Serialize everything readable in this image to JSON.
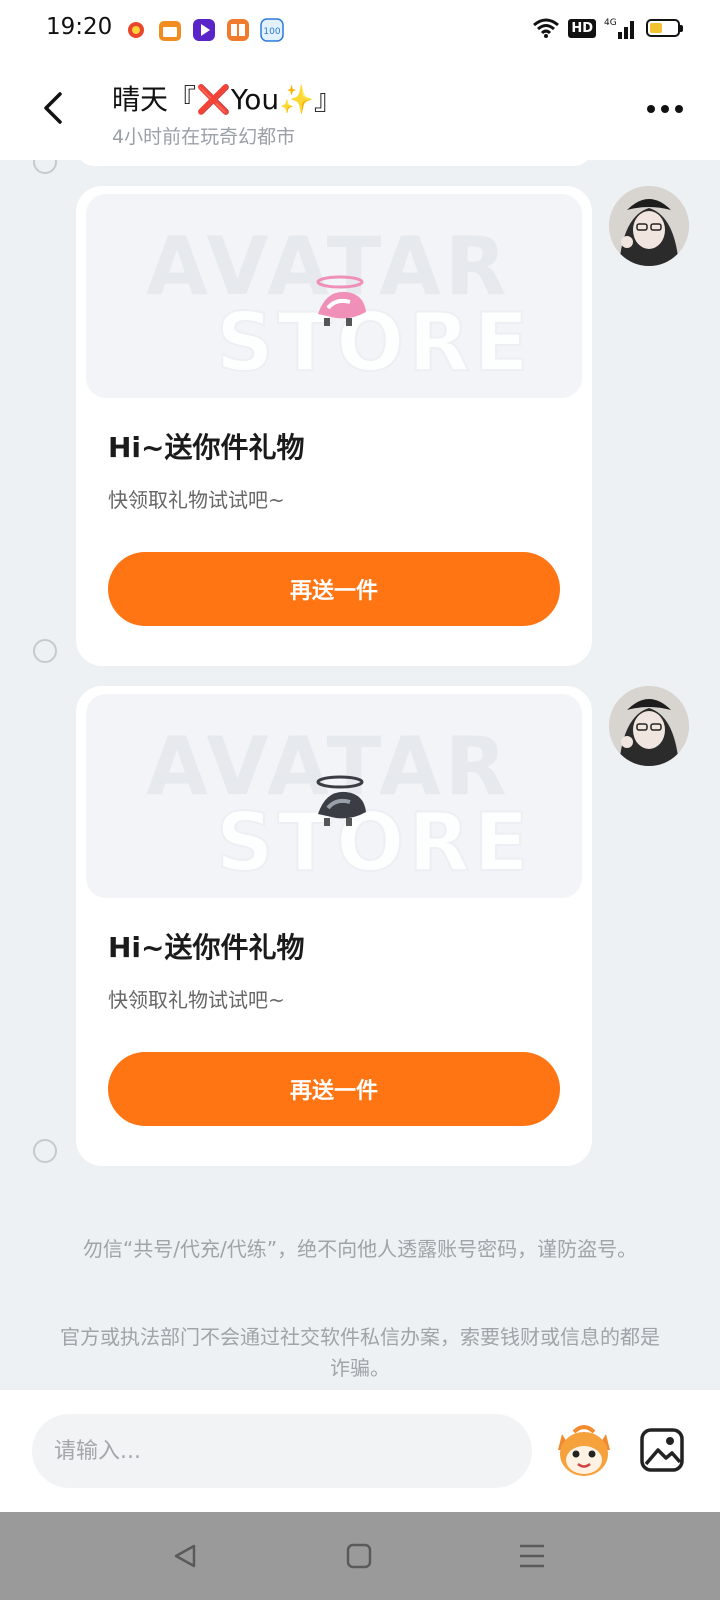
{
  "status_bar": {
    "time": "19:20",
    "app_icons": [
      "weather-icon",
      "calendar-icon",
      "video-icon",
      "book-icon",
      "score-app-icon"
    ],
    "indicators": {
      "hd": "HD",
      "network": "4G"
    }
  },
  "header": {
    "title": "晴天『❌You✨』",
    "subtitle": "4小时前在玩奇幻都市"
  },
  "cards": [
    {
      "title": "Hi~送你件礼物",
      "description": "快领取礼物试试吧~",
      "button": "再送一件",
      "watermark_line1": "AVATAR",
      "watermark_line2": "STORE",
      "item_color": "#f090b8"
    },
    {
      "title": "Hi~送你件礼物",
      "description": "快领取礼物试试吧~",
      "button": "再送一件",
      "watermark_line1": "AVATAR",
      "watermark_line2": "STORE",
      "item_color": "#3a3d44"
    }
  ],
  "notices": [
    "勿信“共号/代充/代练”，绝不向他人透露账号密码，谨防盗号。",
    "官方或执法部门不会通过社交软件私信办案，索要钱财或信息的都是诈骗。"
  ],
  "input_bar": {
    "placeholder": "请输入..."
  },
  "colors": {
    "accent": "#ff7413",
    "background": "#eef1f4",
    "card": "#ffffff"
  }
}
